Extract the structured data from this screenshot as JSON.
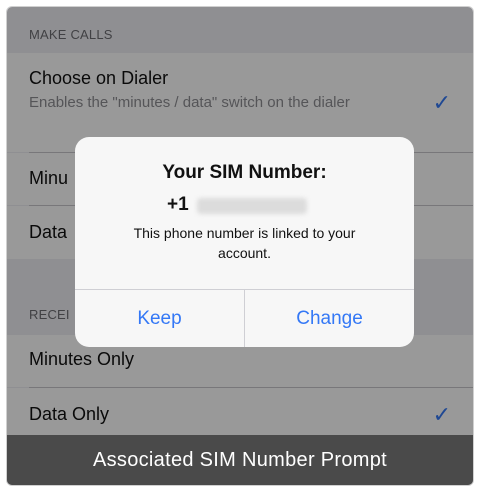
{
  "settings": {
    "make_calls_header": "MAKE CALLS",
    "choose_dialer": {
      "title": "Choose on Dialer",
      "subtitle": "Enables the \"minutes / data\" switch on the dialer",
      "checked_glyph": "✓"
    },
    "minutes_row_partial": "Minu",
    "data_row_partial": "Data",
    "receive_header_partial": "RECEI",
    "minutes_only": "Minutes Only",
    "data_only": {
      "title": "Data Only",
      "checked_glyph": "✓"
    }
  },
  "alert": {
    "title": "Your SIM Number:",
    "phone_prefix": "+1",
    "message": "This phone number is linked to your account.",
    "keep_label": "Keep",
    "change_label": "Change"
  },
  "caption": "Associated SIM Number Prompt",
  "colors": {
    "accent": "#3478f6",
    "caption_bg": "#4a4a4a"
  }
}
